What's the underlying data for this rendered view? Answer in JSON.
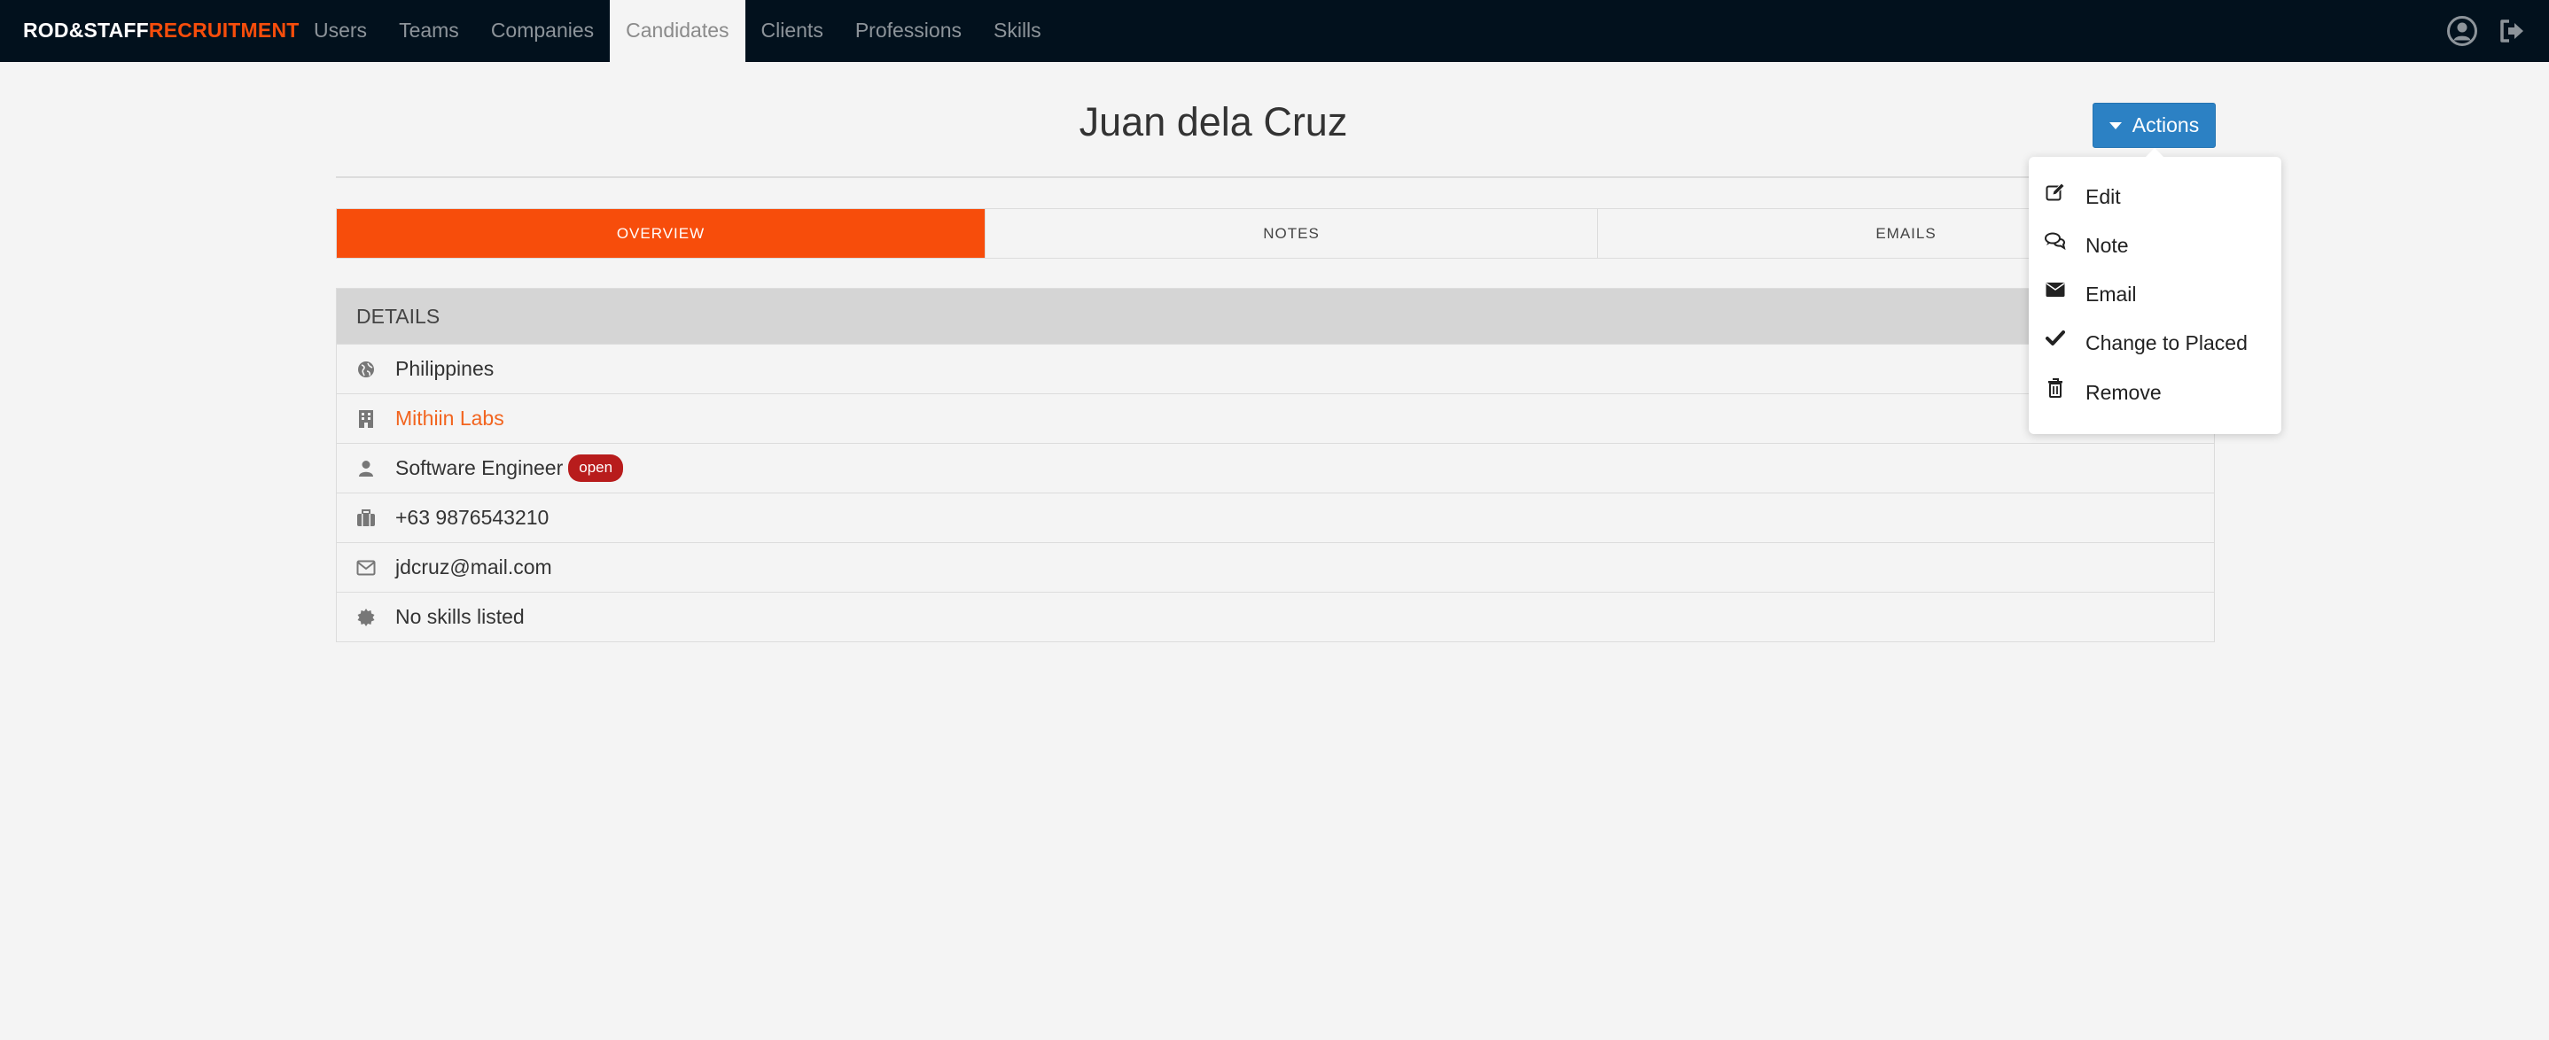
{
  "brand": {
    "part1": "ROD&STAFF",
    "part2": "RECRUITMENT"
  },
  "nav": {
    "items": [
      {
        "label": "Users"
      },
      {
        "label": "Teams"
      },
      {
        "label": "Companies"
      },
      {
        "label": "Candidates",
        "active": true
      },
      {
        "label": "Clients"
      },
      {
        "label": "Professions"
      },
      {
        "label": "Skills"
      }
    ],
    "icons": [
      "user-circle-icon",
      "sign-out-icon"
    ]
  },
  "page": {
    "title": "Juan dela Cruz"
  },
  "actions": {
    "label": "Actions"
  },
  "dropdown": {
    "items": [
      {
        "label": "Edit",
        "icon": "edit-icon"
      },
      {
        "label": "Note",
        "icon": "comments-icon"
      },
      {
        "label": "Email",
        "icon": "envelope-icon"
      },
      {
        "label": "Change to Placed",
        "icon": "check-icon"
      },
      {
        "label": "Remove",
        "icon": "trash-icon"
      }
    ]
  },
  "tabs": [
    {
      "label": "OVERVIEW",
      "active": true
    },
    {
      "label": "NOTES"
    },
    {
      "label": "EMAILS"
    }
  ],
  "details": {
    "header": "DETAILS",
    "country": "Philippines",
    "company": "Mithiin Labs",
    "profession": "Software Engineer",
    "status_badge": "open",
    "phone": "+63 9876543210",
    "email": "jdcruz@mail.com",
    "skills": "No skills listed"
  },
  "colors": {
    "navbar_bg": "#02111d",
    "accent_orange": "#f74d0b",
    "actions_blue": "#2c81c4",
    "badge_red": "#b81c1c",
    "page_bg": "#f4f4f4"
  }
}
